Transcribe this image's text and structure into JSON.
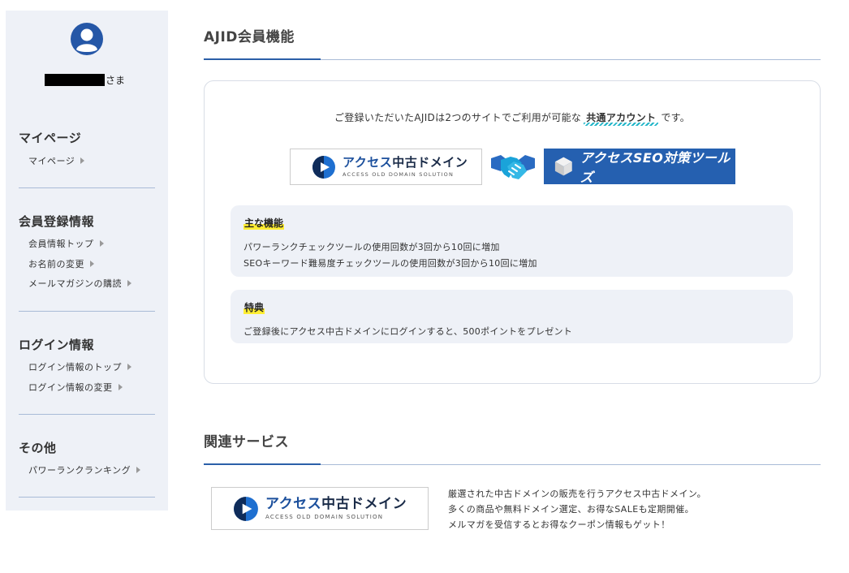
{
  "user": {
    "suffix": "さま"
  },
  "sidebar": {
    "groups": [
      {
        "title": "マイページ",
        "links": [
          "マイページ"
        ]
      },
      {
        "title": "会員登録情報",
        "links": [
          "会員情報トップ",
          "お名前の変更",
          "メールマガジンの購読"
        ]
      },
      {
        "title": "ログイン情報",
        "links": [
          "ログイン情報のトップ",
          "ログイン情報の変更"
        ]
      },
      {
        "title": "その他",
        "links": [
          "パワーランクランキング"
        ]
      }
    ]
  },
  "ajid": {
    "title": "AJID会員機能",
    "intro_before": "ご登録いただいたAJIDは2つのサイトでご利用が可能な",
    "intro_link": "共通アカウント",
    "intro_after": "です。",
    "features": {
      "heading": "主な機能",
      "lines": [
        "パワーランクチェックツールの使用回数が3回から10回に増加",
        "SEOキーワード難易度チェックツールの使用回数が3回から10回に増加"
      ]
    },
    "perks": {
      "heading": "特典",
      "lines": [
        "ご登録後にアクセス中古ドメインにログインすると、500ポイントをプレゼント"
      ]
    }
  },
  "logos": {
    "domain_main_a": "アクセス",
    "domain_main_b": "中古ドメイン",
    "domain_sub": "ACCESS OLD DOMAIN SOLUTION",
    "seo_text": "アクセスSEO対策ツールズ"
  },
  "related": {
    "title": "関連サービス",
    "desc": [
      "厳選された中古ドメインの販売を行うアクセス中古ドメイン。",
      "多くの商品や無料ドメイン選定、お得なSALEも定期開催。",
      "メルマガを受信するとお得なクーポン情報もゲット！"
    ]
  },
  "colors": {
    "accent": "#2b5fa8",
    "sidebar_bg": "#eef1f7",
    "highlight": "#ffee33",
    "banner": "#2560b0"
  }
}
